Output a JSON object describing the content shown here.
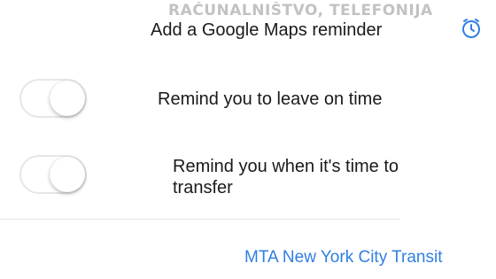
{
  "watermark": "RAČUNALNIŠTVO, TELEFONIJA",
  "reminder": {
    "title": "Add a Google Maps reminder",
    "icon": "clock-icon",
    "accent_color": "#2f7fe3"
  },
  "options": [
    {
      "label": "Remind you to leave on time",
      "toggle_on": false
    },
    {
      "label": "Remind you when it's time to transfer",
      "toggle_on": false
    }
  ],
  "transit_provider": {
    "label": "MTA New York City Transit",
    "color": "#2f7fe3"
  }
}
